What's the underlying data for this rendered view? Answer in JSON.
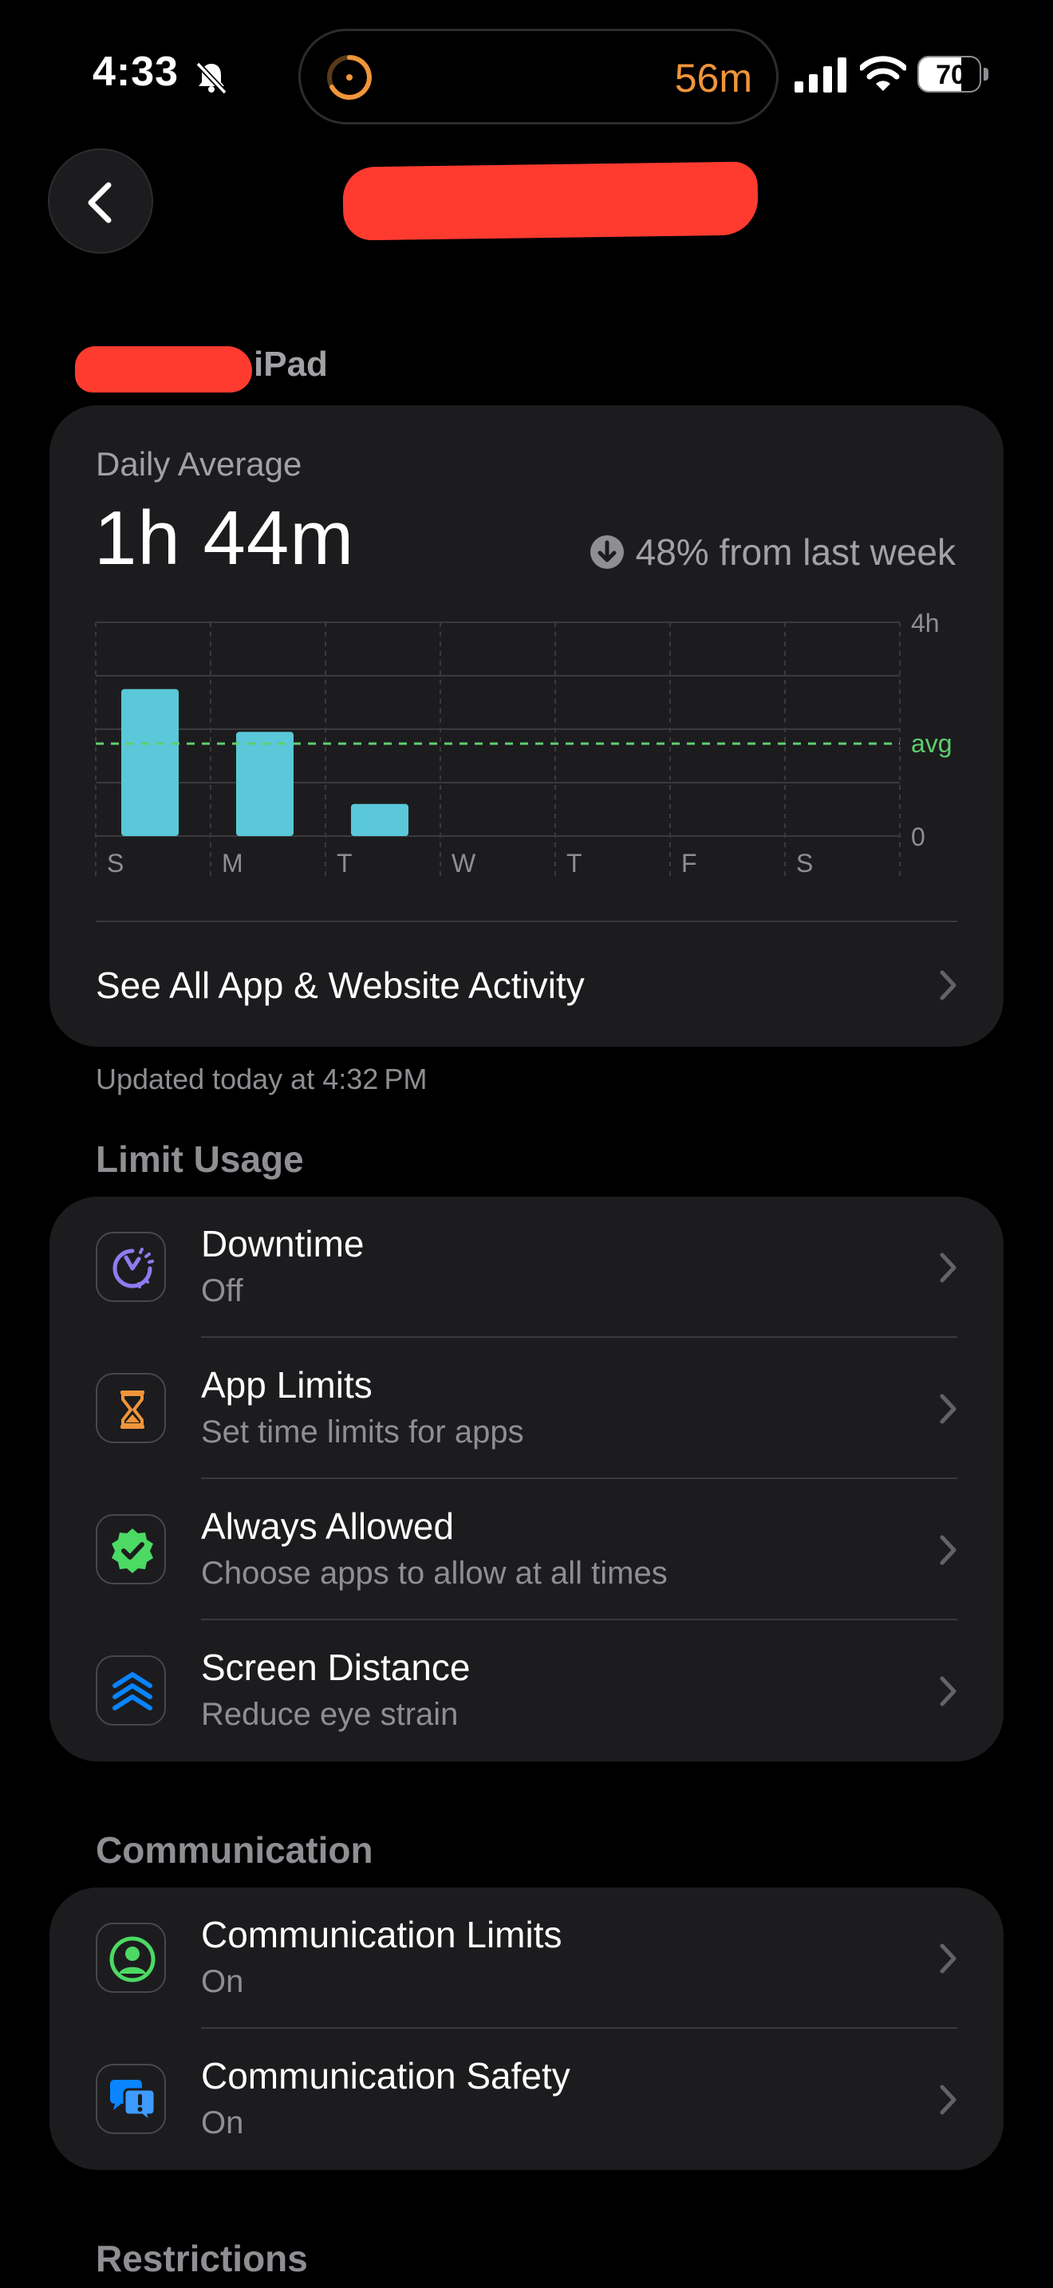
{
  "status_bar": {
    "time": "4:33",
    "island_timer": "56m",
    "battery": "70",
    "battery_fraction": 0.7
  },
  "header": {
    "back_icon": "chevron-left-icon",
    "device_label": "iPad"
  },
  "usage": {
    "daily_label": "Daily Average",
    "daily_value": "1h 44m",
    "delta_icon": "arrow-down-circle-icon",
    "delta_text": "48% from last week",
    "see_all_label": "See All App & Website Activity",
    "updated_text": "Updated today at 4:32 PM"
  },
  "chart_data": {
    "type": "bar",
    "categories": [
      "S",
      "M",
      "T",
      "W",
      "T",
      "F",
      "S"
    ],
    "values": [
      2.75,
      1.95,
      0.6,
      0,
      0,
      0,
      0
    ],
    "ylim": [
      0,
      4
    ],
    "ytick_labels": {
      "top": "4h",
      "bottom": "0"
    },
    "avg_value": 1.73,
    "avg_label": "avg",
    "bar_color": "#5ac8d8",
    "avg_color": "#5fce6d",
    "grid": true
  },
  "limit_usage": {
    "title": "Limit Usage",
    "items": [
      {
        "title": "Downtime",
        "subtitle": "Off",
        "icon": "downtime-icon"
      },
      {
        "title": "App Limits",
        "subtitle": "Set time limits for apps",
        "icon": "hourglass-icon"
      },
      {
        "title": "Always Allowed",
        "subtitle": "Choose apps to allow at all times",
        "icon": "checkmark-seal-icon"
      },
      {
        "title": "Screen Distance",
        "subtitle": "Reduce eye strain",
        "icon": "screen-distance-icon"
      }
    ]
  },
  "communication": {
    "title": "Communication",
    "items": [
      {
        "title": "Communication Limits",
        "subtitle": "On",
        "icon": "person-circle-icon"
      },
      {
        "title": "Communication Safety",
        "subtitle": "On",
        "icon": "message-bubbles-icon"
      }
    ]
  },
  "restrictions": {
    "title": "Restrictions"
  }
}
